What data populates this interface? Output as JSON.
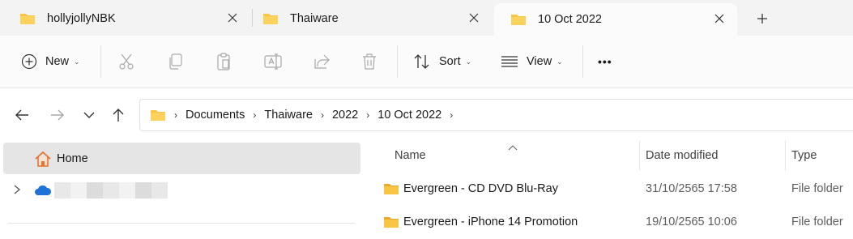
{
  "tabs": [
    {
      "title": "hollyjollyNBK",
      "active": false
    },
    {
      "title": "Thaiware",
      "active": false
    },
    {
      "title": "10 Oct 2022",
      "active": true
    }
  ],
  "new_tab_symbol": "+",
  "toolbar": {
    "new_label": "New",
    "sort_label": "Sort",
    "view_label": "View",
    "more_label": "•••",
    "icons": [
      "cut-icon",
      "copy-icon",
      "paste-icon",
      "rename-icon",
      "share-icon",
      "delete-icon"
    ]
  },
  "breadcrumb": [
    "Documents",
    "Thaiware",
    "2022",
    "10 Oct 2022"
  ],
  "sidebar": {
    "home_label": "Home"
  },
  "filelist": {
    "columns": [
      "Name",
      "Date modified",
      "Type"
    ],
    "rows": [
      {
        "name": "Evergreen - CD DVD Blu-Ray",
        "date": "31/10/2565 17:58",
        "type": "File folder"
      },
      {
        "name": "Evergreen - iPhone 14 Promotion",
        "date": "19/10/2565 10:06",
        "type": "File folder"
      }
    ]
  },
  "colors": {
    "folder": "#f8c644",
    "folder_dark": "#e7a82b",
    "onedrive": "#1f73d8",
    "home_orange": "#e5732e"
  }
}
